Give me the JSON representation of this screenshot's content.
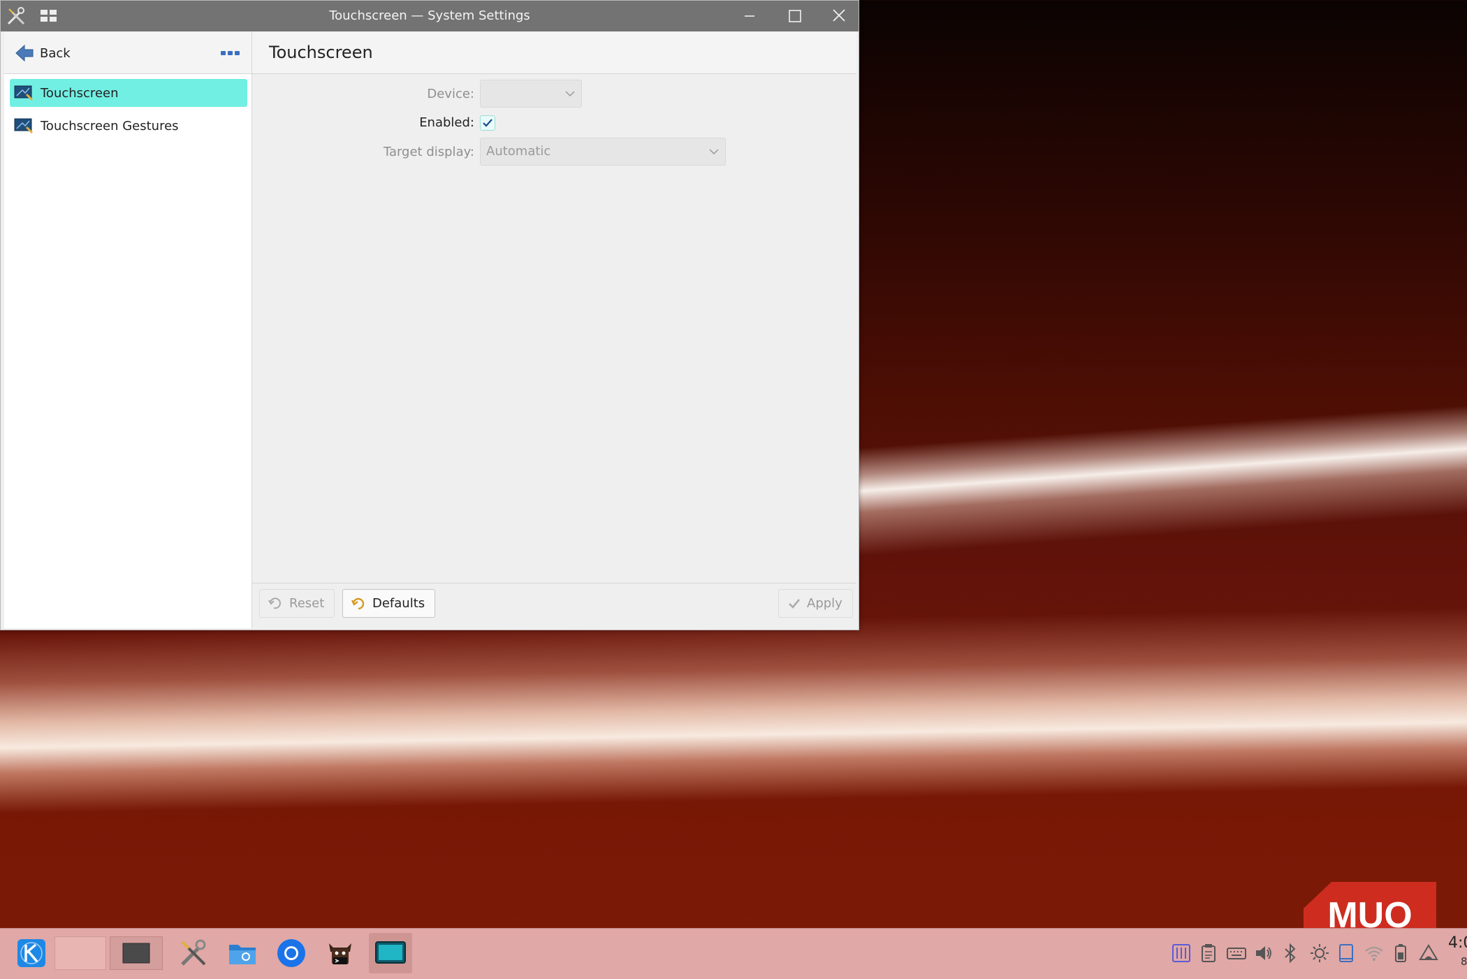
{
  "window": {
    "title": "Touchscreen — System Settings"
  },
  "sidebar": {
    "back_label": "Back",
    "items": [
      {
        "label": "Touchscreen",
        "active": true
      },
      {
        "label": "Touchscreen Gestures",
        "active": false
      }
    ]
  },
  "page": {
    "title": "Touchscreen",
    "fields": {
      "device_label": "Device:",
      "device_value": "",
      "enabled_label": "Enabled:",
      "enabled_checked": true,
      "target_label": "Target display:",
      "target_value": "Automatic"
    },
    "buttons": {
      "reset": "Reset",
      "defaults": "Defaults",
      "apply": "Apply"
    }
  },
  "taskbar": {
    "clock_time": "4:0",
    "clock_date": "8/"
  },
  "watermark": {
    "text": "MUO"
  },
  "colors": {
    "accent": "#72efe3",
    "titlebar": "#737373",
    "taskbar": "#e0a8a6"
  }
}
